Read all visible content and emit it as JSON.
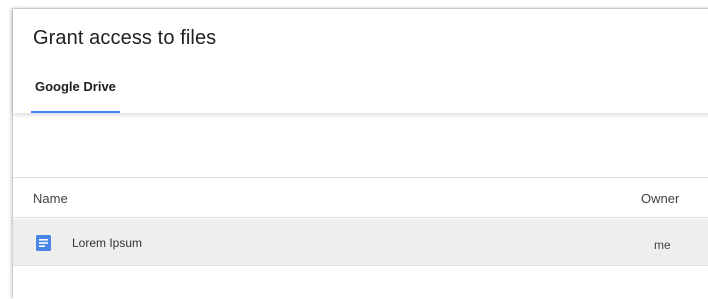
{
  "dialog": {
    "title": "Grant access to files"
  },
  "tabs": [
    {
      "label": "Google Drive",
      "selected": true
    }
  ],
  "table": {
    "columns": [
      "Name",
      "Owner"
    ],
    "rows": [
      {
        "icon": "google-docs-icon",
        "name": "Lorem Ipsum",
        "owner": "me",
        "selected": true
      }
    ]
  },
  "colors": {
    "tab_indicator": "#4285f4",
    "doc_icon": "#4a86e8",
    "selected_row": "#eeeeee"
  }
}
